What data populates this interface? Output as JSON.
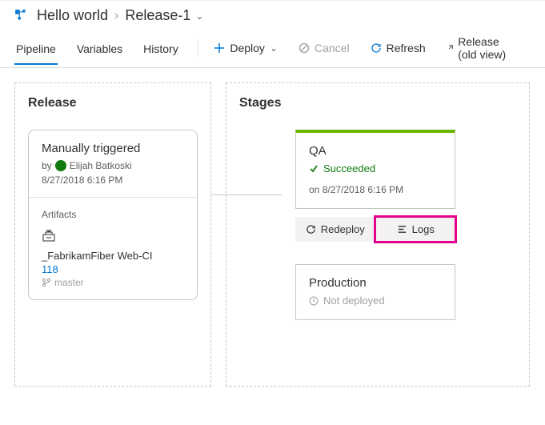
{
  "breadcrumb": {
    "parent": "Hello world",
    "current": "Release-1"
  },
  "tabs": {
    "pipeline": "Pipeline",
    "variables": "Variables",
    "history": "History"
  },
  "actions": {
    "deploy": "Deploy",
    "cancel": "Cancel",
    "refresh": "Refresh",
    "oldview": "Release (old view)"
  },
  "release": {
    "heading": "Release",
    "trigger": "Manually triggered",
    "by_prefix": "by",
    "user": "Elijah Batkoski",
    "timestamp": "8/27/2018 6:16 PM",
    "artifacts_label": "Artifacts",
    "artifact_name": "_FabrikamFiber Web-CI",
    "build_number": "118",
    "branch": "master"
  },
  "stages": {
    "heading": "Stages",
    "qa": {
      "name": "QA",
      "status": "Succeeded",
      "time_prefix": "on",
      "timestamp": "8/27/2018 6:16 PM",
      "redeploy": "Redeploy",
      "logs": "Logs"
    },
    "prod": {
      "name": "Production",
      "status": "Not deployed"
    }
  }
}
